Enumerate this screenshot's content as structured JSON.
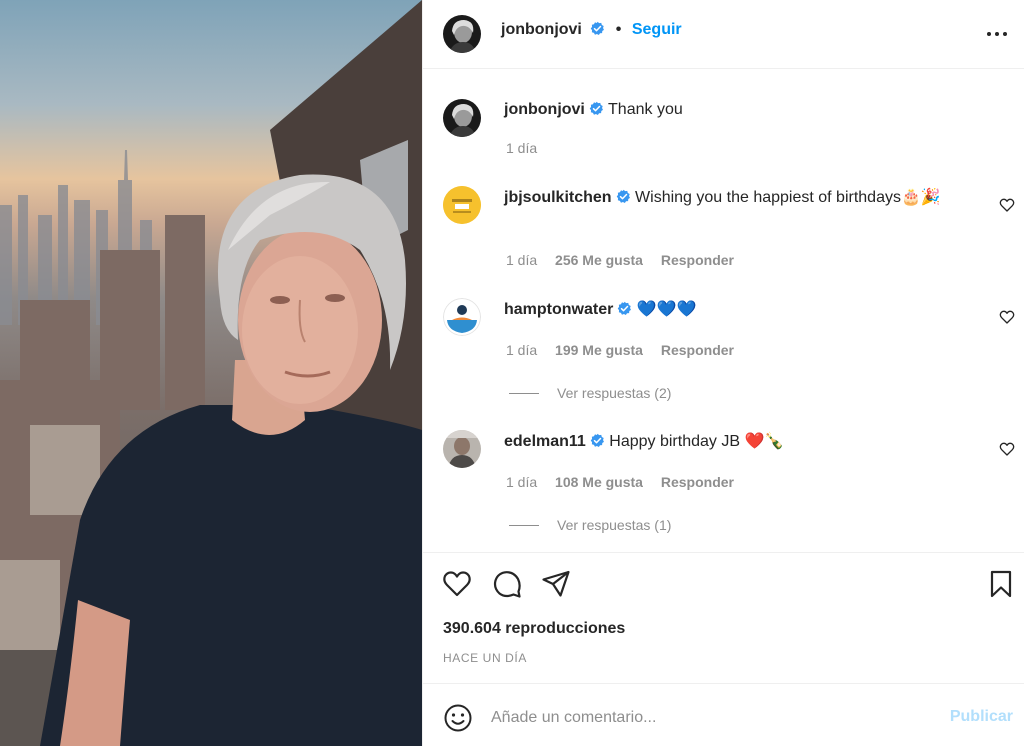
{
  "post": {
    "author": "jonbonjovi",
    "follow_label": "Seguir",
    "dot": "•",
    "caption": "Thank you",
    "caption_time": "1 día"
  },
  "comments": [
    {
      "user": "jbjsoulkitchen",
      "text": "Wishing you the happiest of birthdays🎂🎉",
      "time": "1 día",
      "likes": "256 Me gusta",
      "reply": "Responder",
      "replies": ""
    },
    {
      "user": "hamptonwater",
      "text": "💙💙💙",
      "time": "1 día",
      "likes": "199 Me gusta",
      "reply": "Responder",
      "replies": "Ver respuestas (2)"
    },
    {
      "user": "edelman11",
      "text": "Happy birthday JB ❤️🍾",
      "time": "1 día",
      "likes": "108 Me gusta",
      "reply": "Responder",
      "replies": "Ver respuestas (1)"
    }
  ],
  "stats": {
    "views": "390.604 reproducciones",
    "posted": "HACE UN DÍA"
  },
  "composer": {
    "placeholder": "Añade un comentario...",
    "publish_label": "Publicar"
  },
  "icons": {
    "more": "more-options-icon",
    "like": "heart-icon",
    "comment": "comment-icon",
    "share": "share-icon",
    "save": "bookmark-icon",
    "emoji": "emoji-icon",
    "verified": "verified-badge-icon"
  },
  "colors": {
    "accent": "#0095f6",
    "verified": "#3897f0",
    "muted": "#8e8e8e",
    "publish_disabled": "#b2dffc"
  }
}
